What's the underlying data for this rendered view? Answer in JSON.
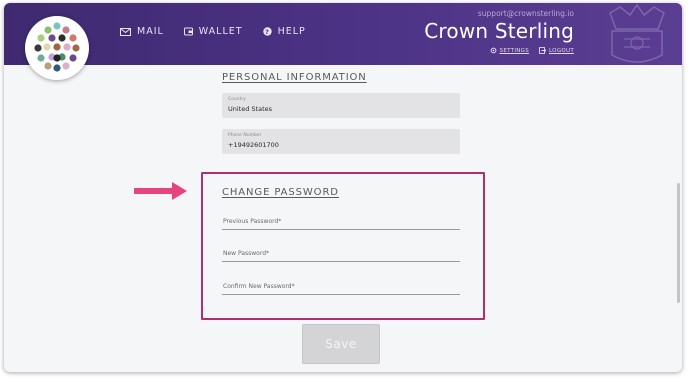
{
  "header": {
    "nav": [
      {
        "label": "MAIL",
        "icon": "mail-icon"
      },
      {
        "label": "WALLET",
        "icon": "wallet-icon"
      },
      {
        "label": "HELP",
        "icon": "help-icon"
      }
    ],
    "support_email": "support@crownsterling.io",
    "brand": "Crown Sterling",
    "settings_label": "SETTINGS",
    "logout_label": "LOGOUT",
    "colors": {
      "header_start": "#3f2a70",
      "header_end": "#5b3e93"
    }
  },
  "personal_info": {
    "title": "PERSONAL INFORMATION",
    "country": {
      "label": "Country",
      "value": "United States"
    },
    "phone": {
      "label": "Phone Number",
      "value": "+19492601700"
    }
  },
  "change_password": {
    "title": "CHANGE PASSWORD",
    "previous_label": "Previous Password*",
    "new_label": "New Password*",
    "confirm_label": "Confirm New Password*",
    "highlight_color": "#b0306e",
    "arrow_color": "#e6437f"
  },
  "actions": {
    "save_label": "Save"
  }
}
